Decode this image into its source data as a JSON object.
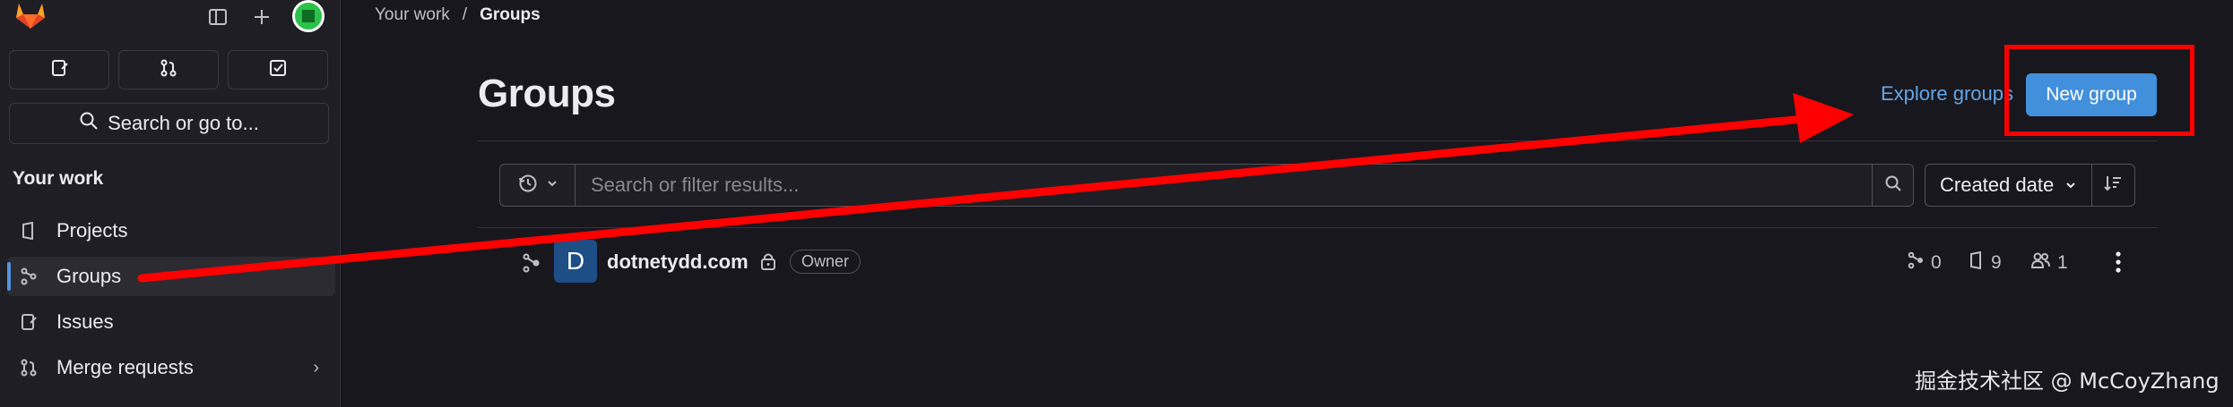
{
  "sidebar": {
    "shortcuts": [
      {
        "icon": "issues-icon"
      },
      {
        "icon": "merge-request-icon"
      },
      {
        "icon": "todo-icon"
      }
    ],
    "search_label": "Search or go to...",
    "context_title": "Your work",
    "items": [
      {
        "label": "Projects",
        "icon": "project-icon"
      },
      {
        "label": "Groups",
        "icon": "group-icon",
        "active": true
      },
      {
        "label": "Issues",
        "icon": "issues-icon"
      },
      {
        "label": "Merge requests",
        "icon": "merge-request-icon",
        "has_children": true
      }
    ]
  },
  "breadcrumb": {
    "parent": "Your work",
    "separator": "/",
    "current": "Groups"
  },
  "page": {
    "title": "Groups",
    "explore_link": "Explore groups",
    "new_button": "New group"
  },
  "filter": {
    "placeholder": "Search or filter results...",
    "sort_label": "Created date"
  },
  "groups": [
    {
      "avatar_letter": "D",
      "name": "dotnetydd.com",
      "visibility": "private",
      "role": "Owner",
      "subgroups": "0",
      "projects": "9",
      "members": "1"
    }
  ],
  "watermark": "掘金技术社区 @ McCoyZhang",
  "colors": {
    "accent": "#428fdc",
    "link": "#63a6e9",
    "annotation": "#ff0000",
    "background": "#18171d",
    "sidebar": "#1f1e24"
  }
}
